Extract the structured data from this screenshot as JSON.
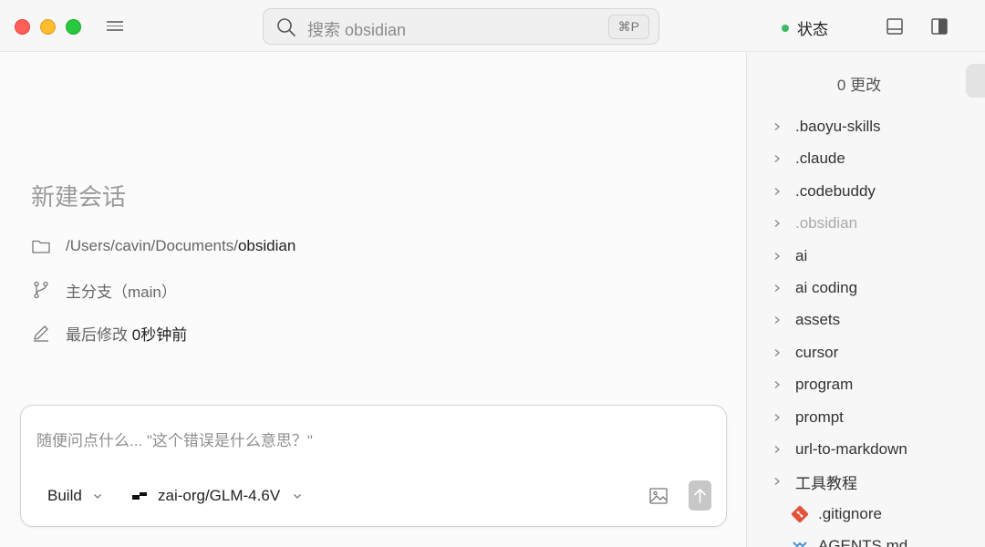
{
  "titlebar": {
    "search_placeholder": "搜索 obsidian",
    "search_shortcut": "⌘P",
    "status_label": "状态",
    "status_color": "#3dbb64"
  },
  "main": {
    "session_title": "新建会话",
    "path_prefix": "/Users/cavin/Documents/",
    "path_folder": "obsidian",
    "branch_label": "主分支（main）",
    "modified_prefix": "最后修改",
    "modified_value": "0秒钟前"
  },
  "composer": {
    "placeholder": "随便问点什么... \"这个错误是什么意思？\"",
    "mode": "Build",
    "model": "zai-org/GLM-4.6V"
  },
  "sidebar": {
    "changes_label": "0 更改",
    "folders": [
      {
        "name": ".baoyu-skills",
        "dim": false
      },
      {
        "name": ".claude",
        "dim": false
      },
      {
        "name": ".codebuddy",
        "dim": false
      },
      {
        "name": ".obsidian",
        "dim": true
      },
      {
        "name": "ai",
        "dim": false
      },
      {
        "name": "ai coding",
        "dim": false
      },
      {
        "name": "assets",
        "dim": false
      },
      {
        "name": "cursor",
        "dim": false
      },
      {
        "name": "program",
        "dim": false
      },
      {
        "name": "prompt",
        "dim": false
      },
      {
        "name": "url-to-markdown",
        "dim": false
      },
      {
        "name": "工具教程",
        "dim": false
      }
    ],
    "files": [
      {
        "name": ".gitignore",
        "icon": "git-icon"
      },
      {
        "name": "AGENTS.md",
        "icon": "markdown-icon"
      }
    ]
  },
  "colors": {
    "accent_status": "#3dbb64",
    "git_icon": "#e2533a",
    "markdown_icon": "#4a90d9"
  }
}
